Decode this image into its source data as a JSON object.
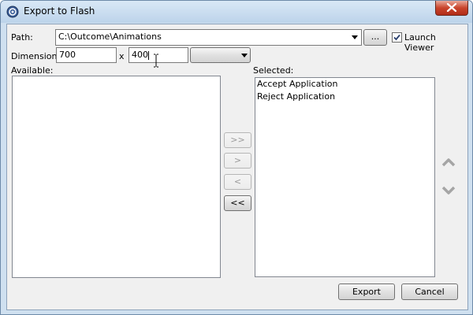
{
  "window": {
    "title": "Export to Flash"
  },
  "path": {
    "label": "Path:",
    "value": "C:\\Outcome\\Animations",
    "browse_label": "..."
  },
  "launch_viewer": {
    "label": "Launch Viewer",
    "checked": true
  },
  "dimension": {
    "label": "Dimension:",
    "width": "700",
    "separator": "x",
    "height": "400",
    "preset_value": ""
  },
  "available": {
    "label": "Available:",
    "items": []
  },
  "selected": {
    "label": "Selected:",
    "items": [
      "Accept Application",
      "Reject Application"
    ]
  },
  "transfer": {
    "add_all": ">>",
    "add": ">",
    "remove": "<",
    "remove_all": "<<"
  },
  "actions": {
    "export_label": "Export",
    "cancel_label": "Cancel"
  },
  "icons": {
    "app": "flash-export-icon",
    "close": "close-icon",
    "move_up": "move-up-icon",
    "move_down": "move-down-icon",
    "dropdown": "chevron-down-icon"
  },
  "colors": {
    "titlebar": "#c7dbef",
    "close": "#c9442c",
    "body": "#f0f0f0"
  }
}
